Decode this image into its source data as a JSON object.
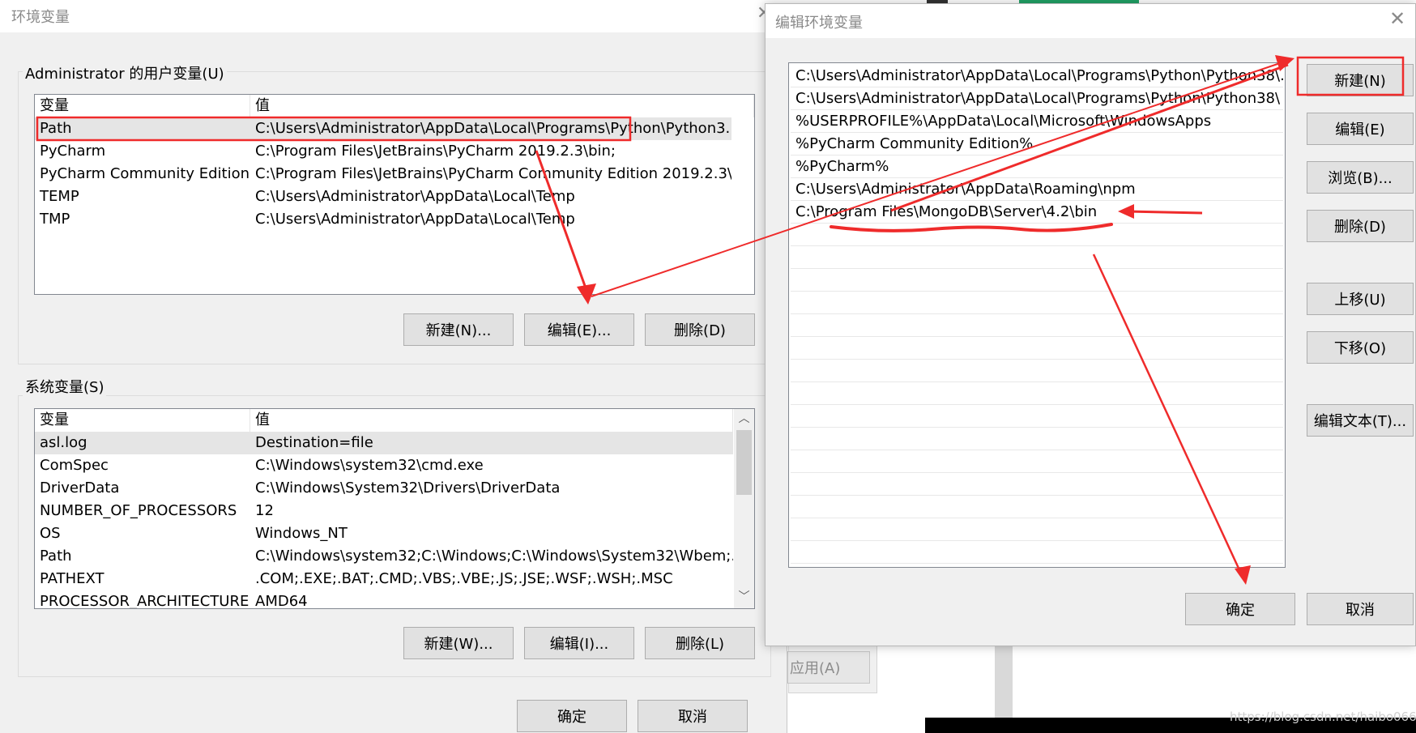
{
  "env_dialog": {
    "title": "环境变量",
    "user_group": {
      "label": "Administrator 的用户变量(U)",
      "col_var": "变量",
      "col_val": "值",
      "rows": [
        {
          "name": "Path",
          "value": "C:\\Users\\Administrator\\AppData\\Local\\Programs\\Python\\Python3..."
        },
        {
          "name": "PyCharm",
          "value": "C:\\Program Files\\JetBrains\\PyCharm 2019.2.3\\bin;"
        },
        {
          "name": "PyCharm Community Edition",
          "value": "C:\\Program Files\\JetBrains\\PyCharm Community Edition 2019.2.3\\..."
        },
        {
          "name": "TEMP",
          "value": "C:\\Users\\Administrator\\AppData\\Local\\Temp"
        },
        {
          "name": "TMP",
          "value": "C:\\Users\\Administrator\\AppData\\Local\\Temp"
        }
      ],
      "btn_new": "新建(N)...",
      "btn_edit": "编辑(E)...",
      "btn_delete": "删除(D)"
    },
    "system_group": {
      "label": "系统变量(S)",
      "col_var": "变量",
      "col_val": "值",
      "rows": [
        {
          "name": "asl.log",
          "value": "Destination=file"
        },
        {
          "name": "ComSpec",
          "value": "C:\\Windows\\system32\\cmd.exe"
        },
        {
          "name": "DriverData",
          "value": "C:\\Windows\\System32\\Drivers\\DriverData"
        },
        {
          "name": "NUMBER_OF_PROCESSORS",
          "value": "12"
        },
        {
          "name": "OS",
          "value": "Windows_NT"
        },
        {
          "name": "Path",
          "value": "C:\\Windows\\system32;C:\\Windows;C:\\Windows\\System32\\Wbem;..."
        },
        {
          "name": "PATHEXT",
          "value": ".COM;.EXE;.BAT;.CMD;.VBS;.VBE;.JS;.JSE;.WSF;.WSH;.MSC"
        },
        {
          "name": "PROCESSOR_ARCHITECTURE",
          "value": "AMD64"
        }
      ],
      "btn_new": "新建(W)...",
      "btn_edit": "编辑(I)...",
      "btn_delete": "删除(L)"
    },
    "btn_ok": "确定",
    "btn_cancel": "取消"
  },
  "background": {
    "apply_button": "应用(A)"
  },
  "edit_dialog": {
    "title": "编辑环境变量",
    "paths": [
      "C:\\Users\\Administrator\\AppData\\Local\\Programs\\Python\\Python38\\...",
      "C:\\Users\\Administrator\\AppData\\Local\\Programs\\Python\\Python38\\",
      "%USERPROFILE%\\AppData\\Local\\Microsoft\\WindowsApps",
      "%PyCharm Community Edition%",
      "%PyCharm%",
      "C:\\Users\\Administrator\\AppData\\Roaming\\npm",
      "C:\\Program Files\\MongoDB\\Server\\4.2\\bin"
    ],
    "btn_new": "新建(N)",
    "btn_edit": "编辑(E)",
    "btn_browse": "浏览(B)...",
    "btn_delete": "删除(D)",
    "btn_up": "上移(U)",
    "btn_down": "下移(O)",
    "btn_edit_text": "编辑文本(T)...",
    "btn_ok": "确定",
    "btn_cancel": "取消"
  },
  "watermark": "https://blog.csdn.net/haibo0668",
  "colors": {
    "annotation_red": "#ef2b2b",
    "dialog_bg": "#f0f0f0",
    "button_bg": "#e1e1e1"
  },
  "icons": {
    "close": "close-icon",
    "scroll_up": "scroll-up-arrow-icon",
    "scroll_down": "scroll-down-arrow-icon"
  }
}
